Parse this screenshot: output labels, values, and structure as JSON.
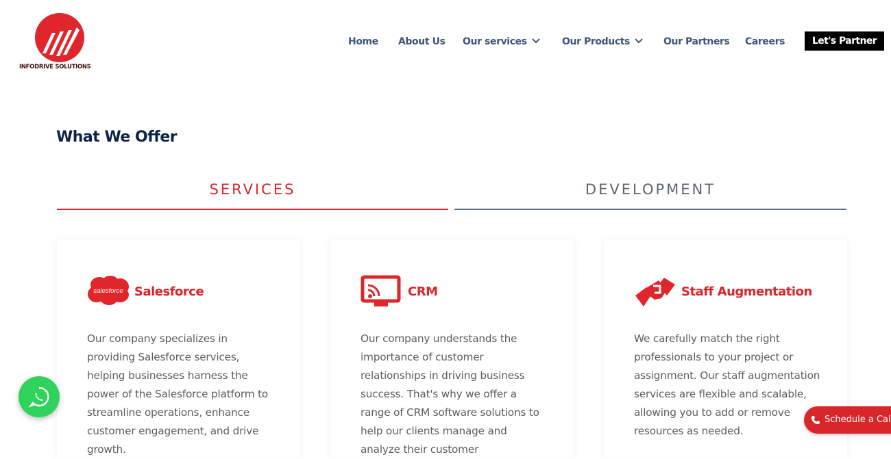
{
  "brand": {
    "name": "INFODRIVE SOLUTIONS"
  },
  "nav": {
    "items": [
      {
        "label": "Home"
      },
      {
        "label": "About Us"
      },
      {
        "label": "Our services"
      },
      {
        "label": "Our Products"
      },
      {
        "label": "Our Partners"
      },
      {
        "label": "Careers"
      }
    ],
    "cta_label": "Let's Partner"
  },
  "section": {
    "title": "What We Offer"
  },
  "tabs": [
    {
      "label": "SERVICES",
      "active": true
    },
    {
      "label": "DEVELOPMENT",
      "active": false
    }
  ],
  "cards": [
    {
      "icon": "salesforce-icon",
      "icon_text": "salesforce",
      "title": "Salesforce",
      "description": "Our company specializes in providing Salesforce services, helping businesses harness the power of the Salesforce platform to streamline operations, enhance customer engagement, and drive growth."
    },
    {
      "icon": "crm-icon",
      "title": "CRM",
      "description": "Our company understands the importance of customer relationships in driving business success. That's why we offer a range of CRM software solutions to help our clients manage and analyze their customer"
    },
    {
      "icon": "handshake-icon",
      "title": "Staff Augmentation",
      "description": "We carefully match the right professionals to your project or assignment. Our staff augmentation services are flexible and scalable, allowing you to add or remove resources as needed."
    }
  ],
  "floating": {
    "schedule_label": "Schedule a Call"
  },
  "colors": {
    "accent": "#d8262b",
    "nav": "#3e5678",
    "heading": "#0e2146",
    "whatsapp": "#2fd35c"
  }
}
